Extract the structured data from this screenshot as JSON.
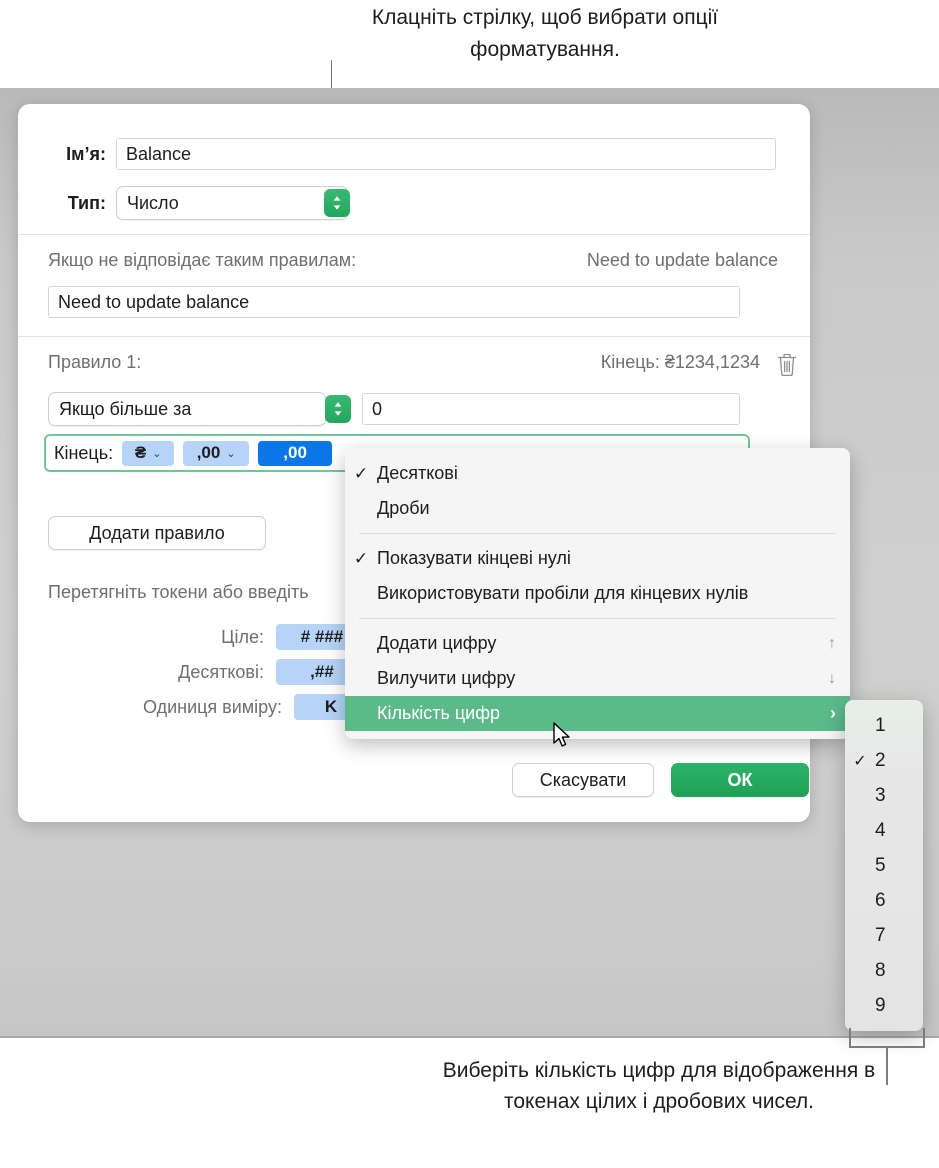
{
  "callouts": {
    "top": "Клацніть стрілку, щоб вибрати опції форматування.",
    "bottom": "Виберіть кількість цифр для відображення в токенах цілих і дробових чисел."
  },
  "dialog": {
    "name_label": "Ім’я:",
    "name_value": "Balance",
    "type_label": "Тип:",
    "type_value": "Число",
    "mismatch_label": "Якщо не відповідає таким правилам:",
    "mismatch_preview": "Need to update balance",
    "mismatch_value": "Need to update balance",
    "rule_label": "Правило 1:",
    "rule_preview": "Кінець: ₴1234,1234",
    "delete_icon": "trash-icon",
    "condition_value": "Якщо більше за",
    "condition_number": "0",
    "token_strip_label": "Кінець:",
    "tokens": [
      {
        "text": "₴",
        "caret": "⌄",
        "selected": false
      },
      {
        "text": ",00",
        "caret": "⌄",
        "selected": false
      },
      {
        "text": ",00",
        "caret": "",
        "selected": true
      }
    ],
    "add_rule_label": "Додати правило",
    "drag_hint": "Перетягніть токени або введіть",
    "format_rows": [
      {
        "label": "Ціле:",
        "token": "# ###"
      },
      {
        "label": "Десяткові:",
        "token": ",##"
      },
      {
        "label": "Одиниця виміру:",
        "token": "K"
      }
    ],
    "cancel_label": "Скасувати",
    "ok_label": "ОК"
  },
  "menu": {
    "items": [
      {
        "label": "Десяткові",
        "checked": true,
        "accessory": "",
        "highlighted": false
      },
      {
        "label": "Дроби",
        "checked": false,
        "accessory": "",
        "highlighted": false
      },
      {
        "separator": true
      },
      {
        "label": "Показувати кінцеві нулі",
        "checked": true,
        "accessory": "",
        "highlighted": false
      },
      {
        "label": "Використовувати пробіли для кінцевих нулів",
        "checked": false,
        "accessory": "",
        "highlighted": false
      },
      {
        "separator": true
      },
      {
        "label": "Додати цифру",
        "checked": false,
        "accessory": "↑",
        "highlighted": false
      },
      {
        "label": "Вилучити цифру",
        "checked": false,
        "accessory": "↓",
        "highlighted": false
      },
      {
        "label": "Кількість цифр",
        "checked": false,
        "accessory": "›",
        "highlighted": true
      }
    ]
  },
  "submenu": {
    "items": [
      {
        "label": "1",
        "checked": false
      },
      {
        "label": "2",
        "checked": true
      },
      {
        "label": "3",
        "checked": false
      },
      {
        "label": "4",
        "checked": false
      },
      {
        "label": "5",
        "checked": false
      },
      {
        "label": "6",
        "checked": false
      },
      {
        "label": "7",
        "checked": false
      },
      {
        "label": "8",
        "checked": false
      },
      {
        "label": "9",
        "checked": false
      }
    ]
  },
  "colors": {
    "accent_green": "#22a65c",
    "menu_highlight": "#5cb98a",
    "token_blue": "#b6d4f7",
    "token_selected_blue": "#0a76e8",
    "strip_border": "#72c49a"
  }
}
